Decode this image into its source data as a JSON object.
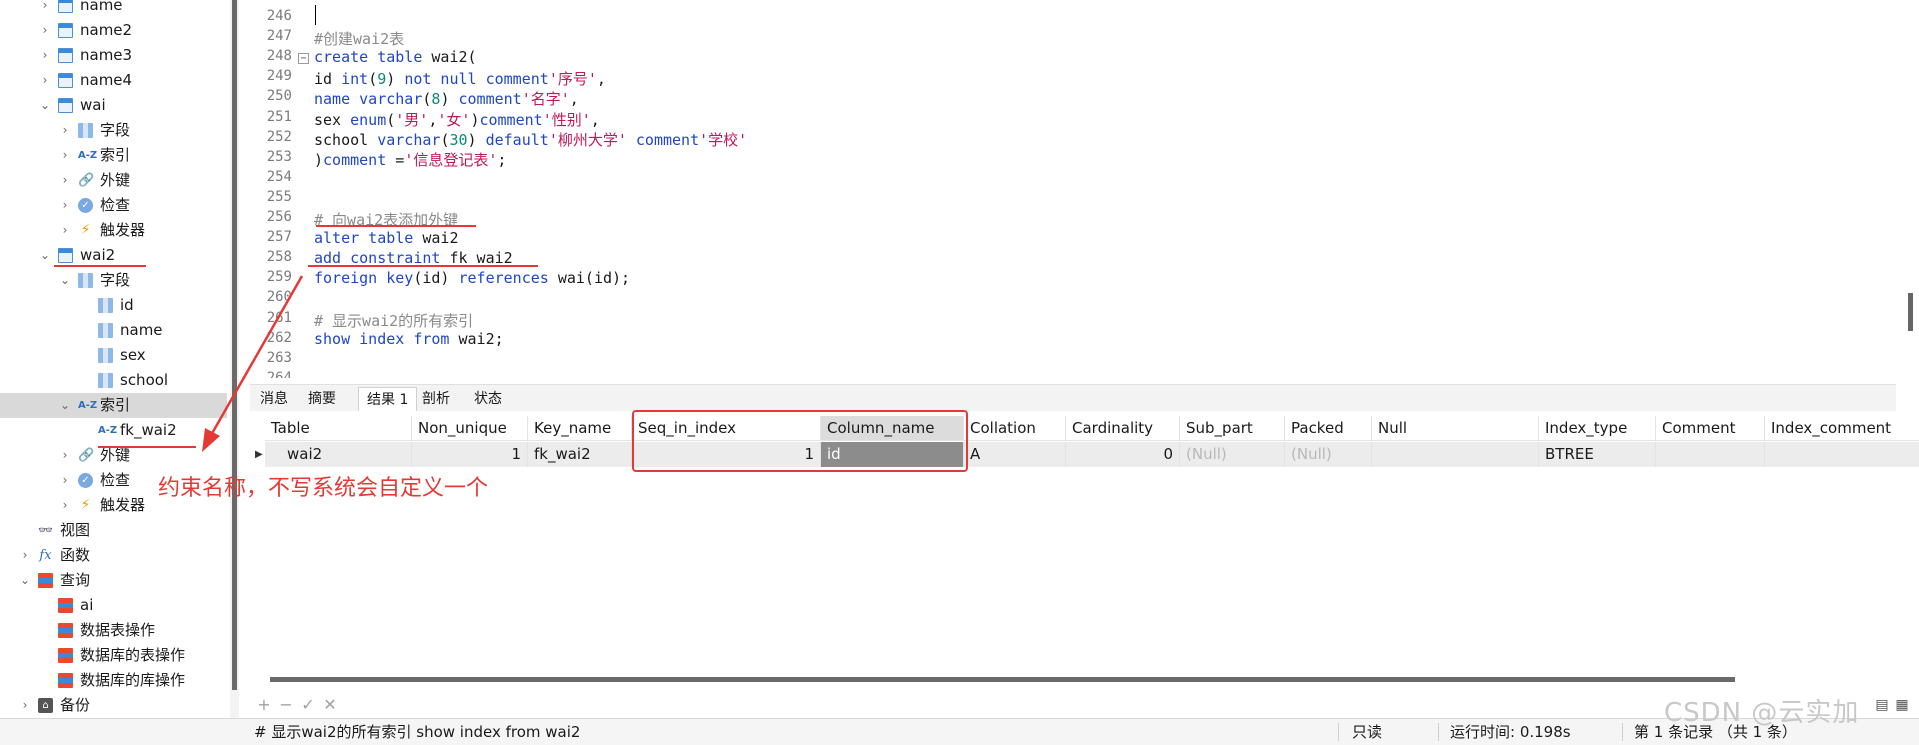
{
  "tree": {
    "items": [
      {
        "label": "name",
        "icon": "table-icon",
        "level": 1,
        "chev": "›"
      },
      {
        "label": "name2",
        "icon": "table-icon",
        "level": 1,
        "chev": "›"
      },
      {
        "label": "name3",
        "icon": "table-icon",
        "level": 1,
        "chev": "›"
      },
      {
        "label": "name4",
        "icon": "table-icon",
        "level": 1,
        "chev": "›"
      },
      {
        "label": "wai",
        "icon": "table-icon",
        "level": 1,
        "chev": "⌄"
      },
      {
        "label": "字段",
        "icon": "columns-icon",
        "level": 2,
        "chev": "›"
      },
      {
        "label": "索引",
        "icon": "index-icon",
        "level": 2,
        "chev": "›"
      },
      {
        "label": "外键",
        "icon": "foreign-key-icon",
        "level": 2,
        "chev": "›"
      },
      {
        "label": "检查",
        "icon": "check-icon",
        "level": 2,
        "chev": "›"
      },
      {
        "label": "触发器",
        "icon": "trigger-icon",
        "level": 2,
        "chev": "›"
      },
      {
        "label": "wai2",
        "icon": "table-icon",
        "level": 1,
        "chev": "⌄"
      },
      {
        "label": "字段",
        "icon": "columns-icon",
        "level": 2,
        "chev": "⌄"
      },
      {
        "label": "id",
        "icon": "column-icon",
        "level": 3,
        "chev": ""
      },
      {
        "label": "name",
        "icon": "column-icon",
        "level": 3,
        "chev": ""
      },
      {
        "label": "sex",
        "icon": "column-icon",
        "level": 3,
        "chev": ""
      },
      {
        "label": "school",
        "icon": "column-icon",
        "level": 3,
        "chev": ""
      },
      {
        "label": "索引",
        "icon": "index-icon",
        "level": 2,
        "chev": "⌄",
        "selected": true
      },
      {
        "label": "fk_wai2",
        "icon": "index-icon",
        "level": 3,
        "chev": ""
      },
      {
        "label": "外键",
        "icon": "foreign-key-icon",
        "level": 2,
        "chev": "›"
      },
      {
        "label": "检查",
        "icon": "check-icon",
        "level": 2,
        "chev": "›"
      },
      {
        "label": "触发器",
        "icon": "trigger-icon",
        "level": 2,
        "chev": "›"
      },
      {
        "label": "视图",
        "icon": "view-icon",
        "level": 0,
        "chev": ""
      },
      {
        "label": "函数",
        "icon": "function-icon",
        "level": 0,
        "chev": "›"
      },
      {
        "label": "查询",
        "icon": "query-icon",
        "level": 0,
        "chev": "⌄"
      },
      {
        "label": "ai",
        "icon": "query-icon",
        "level": 1,
        "chev": ""
      },
      {
        "label": "数据表操作",
        "icon": "query-icon",
        "level": 1,
        "chev": ""
      },
      {
        "label": "数据库的表操作",
        "icon": "query-icon",
        "level": 1,
        "chev": ""
      },
      {
        "label": "数据库的库操作",
        "icon": "query-icon",
        "level": 1,
        "chev": ""
      },
      {
        "label": "备份",
        "icon": "backup-icon",
        "level": 0,
        "chev": "›"
      }
    ]
  },
  "editor": {
    "top_partial_line": "245",
    "lines": [
      {
        "n": "246",
        "html": ""
      },
      {
        "n": "247",
        "html": "<span class='cm'>#创建wai2表</span>"
      },
      {
        "n": "248",
        "html": "<span class='kw'>create table</span> wai2(",
        "fold": true
      },
      {
        "n": "249",
        "html": "id <span class='kw'>int</span>(<span class='num'>9</span>) <span class='kw'>not null comment</span><span class='str'>'序号'</span>,"
      },
      {
        "n": "250",
        "html": "<span class='kw'>name varchar</span>(<span class='num'>8</span>) <span class='kw'>comment</span><span class='str'>'名字'</span>,"
      },
      {
        "n": "251",
        "html": "sex <span class='kw'>enum</span>(<span class='str'>'男'</span>,<span class='str'>'女'</span>)<span class='kw'>comment</span><span class='str'>'性别'</span>,"
      },
      {
        "n": "252",
        "html": "school <span class='kw'>varchar</span>(<span class='num'>30</span>) <span class='kw'>default</span><span class='str'>'柳州大学'</span> <span class='kw'>comment</span><span class='str'>'学校'</span>"
      },
      {
        "n": "253",
        "html": ")<span class='kw'>comment</span> =<span class='str'>'信息登记表'</span>;"
      },
      {
        "n": "254",
        "html": ""
      },
      {
        "n": "255",
        "html": ""
      },
      {
        "n": "256",
        "html": "<span class='cm'># 向wai2表添加外键</span>"
      },
      {
        "n": "257",
        "html": "<span class='kw'>alter table</span> wai2"
      },
      {
        "n": "258",
        "html": "<span class='kw'>add constraint</span> fk_wai2"
      },
      {
        "n": "259",
        "html": "<span class='kw'>foreign key</span>(id) <span class='kw'>references</span> wai(id);"
      },
      {
        "n": "260",
        "html": ""
      },
      {
        "n": "261",
        "html": "<span class='cm'># 显示wai2的所有索引</span>"
      },
      {
        "n": "262",
        "html": "<span class='kw'>show index from</span> wai2;"
      },
      {
        "n": "263",
        "html": ""
      },
      {
        "n": "264",
        "html": ""
      }
    ]
  },
  "result_tabs": [
    "消息",
    "摘要",
    "结果 1",
    "剖析",
    "状态"
  ],
  "active_tab": "结果 1",
  "grid": {
    "columns": [
      "Table",
      "Non_unique",
      "Key_name",
      "Seq_in_index",
      "Column_name",
      "Collation",
      "Cardinality",
      "Sub_part",
      "Packed",
      "Null",
      "Index_type",
      "Comment",
      "Index_comment"
    ],
    "row": [
      "wai2",
      "1",
      "fk_wai2",
      "1",
      "id",
      "A",
      "0",
      "(Null)",
      "(Null)",
      "",
      "BTREE",
      "",
      ""
    ]
  },
  "grid_toolbar": [
    "+",
    "−",
    "✓",
    "✕"
  ],
  "status": {
    "query": "# 显示wai2的所有索引 show index from wai2",
    "mode": "只读",
    "runtime": "运行时间: 0.198s",
    "records": "第 1 条记录 （共 1 条）"
  },
  "annotation": "约束名称，不写系统会自定义一个",
  "watermark": "CSDN @云实加",
  "colors": {
    "annotation_red": "#e53935",
    "keyword_blue": "#1f46c8",
    "string_red": "#c2185b"
  }
}
